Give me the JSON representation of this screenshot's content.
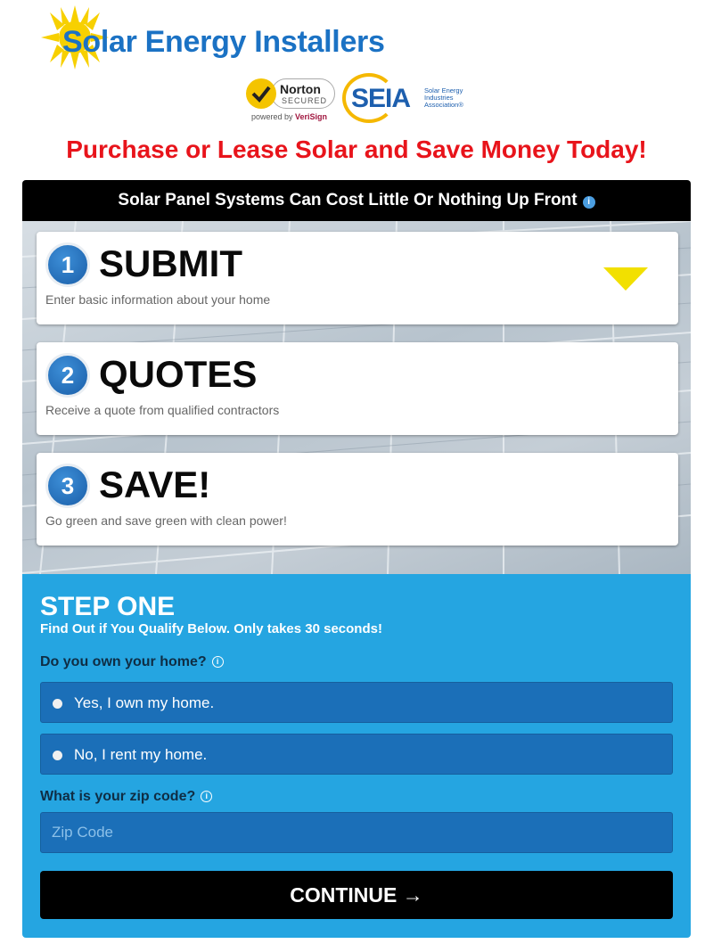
{
  "header": {
    "brand": "Solar Energy Installers"
  },
  "badges": {
    "norton_name": "Norton",
    "norton_secured": "SECURED",
    "norton_powered_prefix": "powered by ",
    "norton_powered_brand": "VeriSign",
    "seia_word": "SEIA",
    "seia_sub": "Solar Energy Industries Association®"
  },
  "headline": "Purchase or Lease Solar and Save Money Today!",
  "topbar": {
    "text": "Solar Panel Systems Can Cost Little Or Nothing Up Front",
    "info": "i"
  },
  "steps": [
    {
      "num": "1",
      "title": "SUBMIT",
      "desc": "Enter basic information about your home"
    },
    {
      "num": "2",
      "title": "QUOTES",
      "desc": "Receive a quote from qualified contractors"
    },
    {
      "num": "3",
      "title": "SAVE!",
      "desc": "Go green and save green with clean power!"
    }
  ],
  "form": {
    "heading": "STEP ONE",
    "subheading": "Find Out if You Qualify Below. Only takes 30 seconds!",
    "q1": "Do you own your home?",
    "options": [
      "Yes, I own my home.",
      "No, I rent my home."
    ],
    "q2": "What is your zip code?",
    "zip_placeholder": "Zip Code",
    "info": "i",
    "continue": "CONTINUE →"
  },
  "colors": {
    "brand_blue": "#1b72c4",
    "headline_red": "#e8141b",
    "form_blue": "#25a5e1",
    "arrow_yellow": "#f2e000"
  }
}
